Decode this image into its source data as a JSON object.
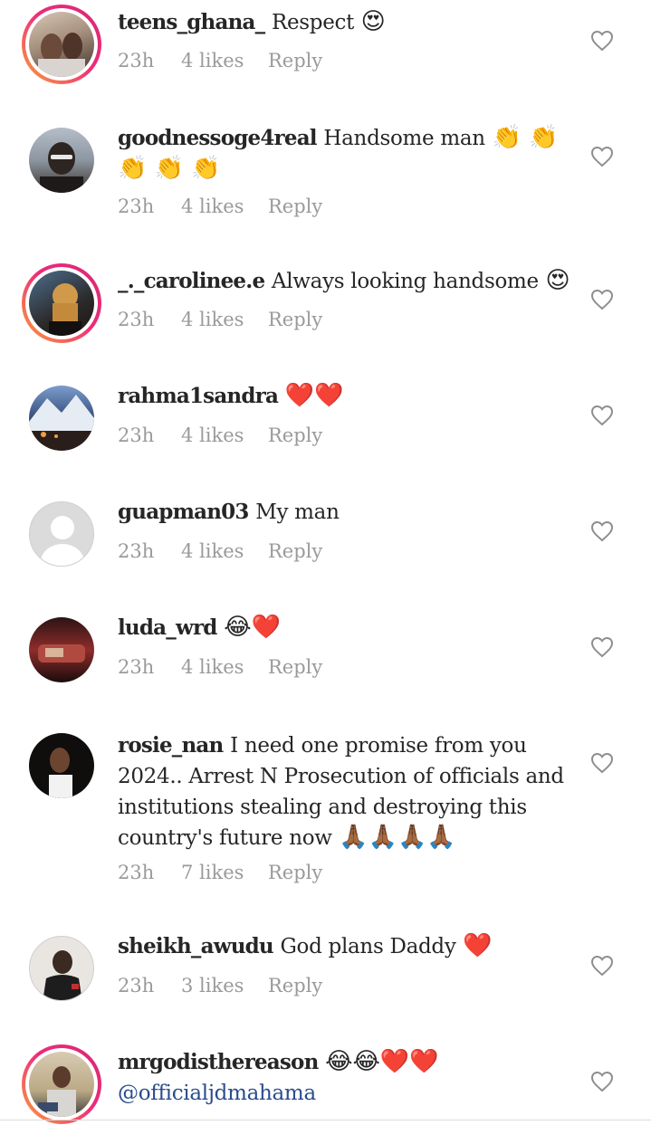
{
  "comments": [
    {
      "username": "teens_ghana_",
      "text": "Respect",
      "emoji": "😍",
      "time": "23h",
      "likes": "4 likes",
      "reply": "Reply",
      "story_ring": true,
      "avatar_colors": [
        "#c9b7a6",
        "#3a2f2a"
      ]
    },
    {
      "username": "goodnessoge4real",
      "text": "Handsome man",
      "emoji": "👏 👏 👏 👏 👏",
      "time": "23h",
      "likes": "4 likes",
      "reply": "Reply",
      "story_ring": false,
      "avatar_colors": [
        "#a9b3be",
        "#2c2522"
      ]
    },
    {
      "username": "_._carolinee.e",
      "text": "Always looking handsome",
      "emoji": "😍",
      "time": "23h",
      "likes": "4 likes",
      "reply": "Reply",
      "story_ring": true,
      "avatar_colors": [
        "#c48a3c",
        "#1d1714"
      ]
    },
    {
      "username": "rahma1sandra",
      "text": "",
      "emoji": "❤️❤️",
      "time": "23h",
      "likes": "4 likes",
      "reply": "Reply",
      "story_ring": false,
      "avatar_colors": [
        "#5b7fb5",
        "#1a2235"
      ]
    },
    {
      "username": "guapman03",
      "text": "My man",
      "emoji": "",
      "time": "23h",
      "likes": "4 likes",
      "reply": "Reply",
      "story_ring": false,
      "avatar_colors": [
        "#dbdbdb",
        "#ffffff"
      ]
    },
    {
      "username": "luda_wrd",
      "text": "",
      "emoji": "😂❤️",
      "time": "23h",
      "likes": "4 likes",
      "reply": "Reply",
      "story_ring": false,
      "avatar_colors": [
        "#8e2d2a",
        "#1b0c0c"
      ]
    },
    {
      "username": "rosie_nan",
      "text": "I need one promise from you 2024.. Arrest N Prosecution of officials and institutions stealing and destroying this country's future now",
      "emoji": "🙏🏾🙏🏾🙏🏾🙏🏾",
      "time": "23h",
      "likes": "7 likes",
      "reply": "Reply",
      "story_ring": false,
      "avatar_colors": [
        "#2c2a28",
        "#0a0a0a"
      ]
    },
    {
      "username": "sheikh_awudu",
      "text": "God plans Daddy",
      "emoji": "❤️",
      "time": "23h",
      "likes": "3 likes",
      "reply": "Reply",
      "story_ring": false,
      "avatar_colors": [
        "#e9e6e2",
        "#1d1d1d"
      ]
    },
    {
      "username": "mrgodisthereason",
      "text": "",
      "emoji": "😂😂❤️❤️",
      "mention": "@officialjdmahama",
      "story_ring": true,
      "avatar_colors": [
        "#c7b79c",
        "#3b3a3c"
      ]
    }
  ],
  "icons": {
    "like": "heart-outline-icon"
  }
}
